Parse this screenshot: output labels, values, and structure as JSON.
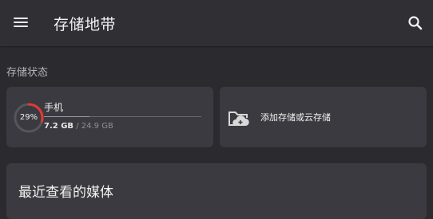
{
  "app": {
    "title": "存储地带"
  },
  "icons": {
    "menu": "menu-icon",
    "search": "search-icon",
    "add_storage": "cloud-add-icon"
  },
  "colors": {
    "accent": "#e53935",
    "background": "#2a2a2f",
    "card": "#3a3a40"
  },
  "storage_status": {
    "section_label": "存储状态",
    "device": {
      "name": "手机",
      "percent_label": "29%",
      "used_fraction": 0.29,
      "used": "7.2 GB",
      "separator": "/",
      "total": "24.9 GB"
    },
    "add_label": "添加存储或云存储"
  },
  "recent_media": {
    "title": "最近查看的媒体"
  }
}
